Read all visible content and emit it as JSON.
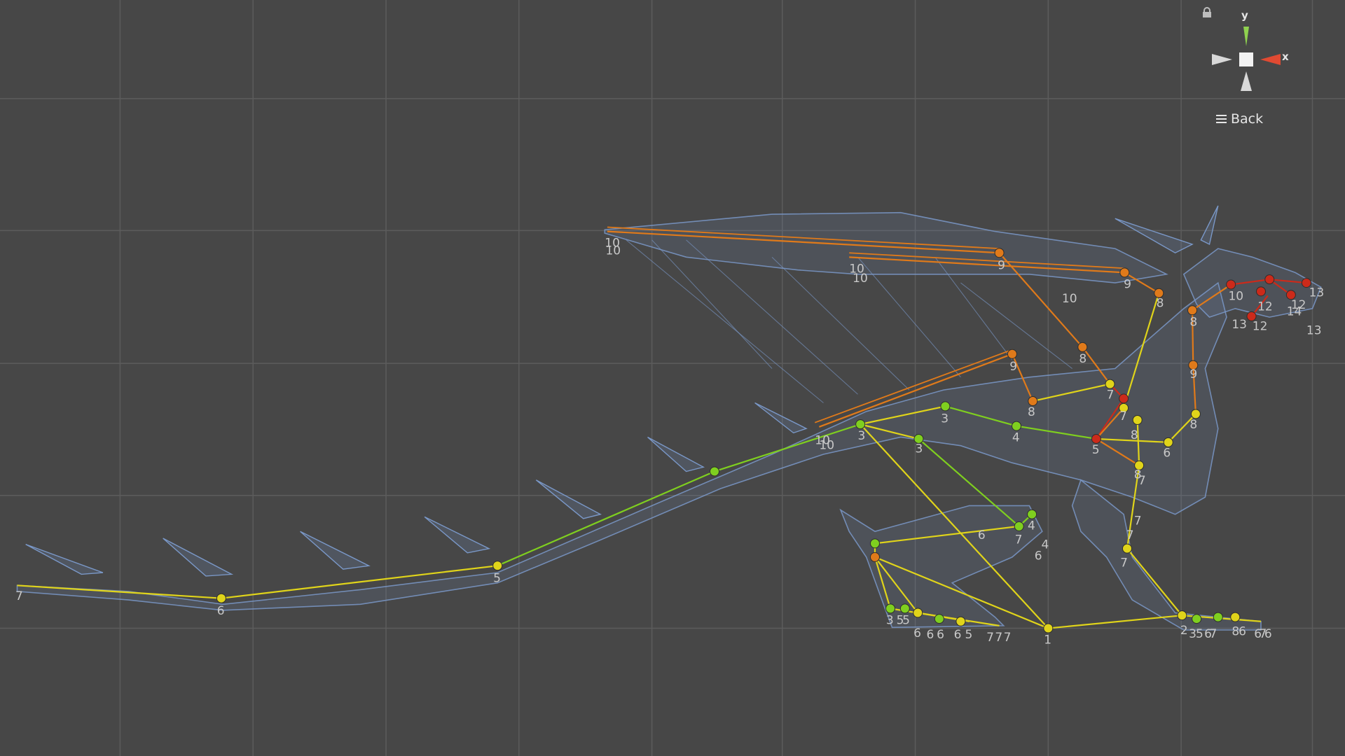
{
  "scene_view": {
    "background": "#474747",
    "grid_color": "#5c5c5c",
    "mesh_color": "#7a98c8"
  },
  "gizmo": {
    "y_label": "y",
    "x_label": "x",
    "lock_icon": "lock-icon",
    "y_color": "#8fd14f",
    "x_color": "#e04a32"
  },
  "back_button": {
    "label": "Back",
    "icon": "menu-icon"
  },
  "bone_colors": {
    "green": "#7fcf1f",
    "yellow": "#e0d41a",
    "orange": "#e07a1a",
    "red": "#cc2a1a"
  },
  "bone_labels": [
    "10",
    "10",
    "10",
    "10",
    "9",
    "9",
    "8",
    "10",
    "10",
    "8",
    "8",
    "9",
    "8",
    "12",
    "14",
    "13",
    "13",
    "12",
    "13",
    "12",
    "9",
    "8",
    "7",
    "7",
    "7",
    "8",
    "8",
    "3",
    "3",
    "3",
    "4",
    "5",
    "6",
    "6",
    "6",
    "7",
    "7",
    "4",
    "4",
    "5",
    "6",
    "7",
    "3",
    "5",
    "5",
    "6",
    "6",
    "5",
    "6",
    "6",
    "7",
    "7",
    "7",
    "1",
    "2",
    "3",
    "5",
    "6",
    "7",
    "8",
    "6",
    "6",
    "7",
    "6",
    "7",
    "7",
    "10",
    "10"
  ]
}
